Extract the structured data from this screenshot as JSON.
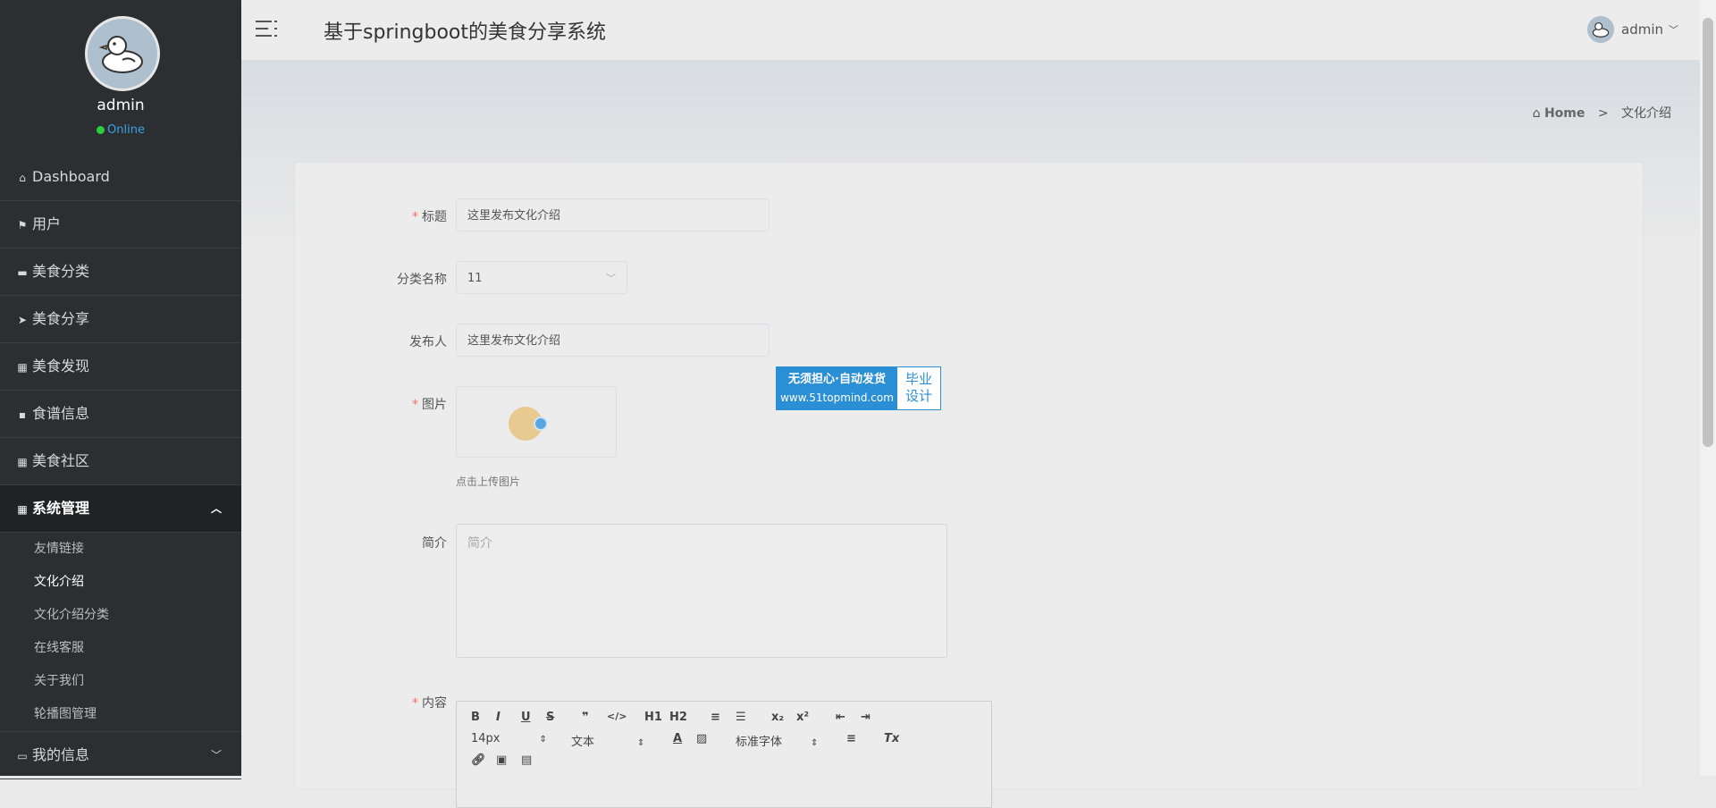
{
  "sidebar": {
    "user_name": "admin",
    "status": "Online",
    "items": [
      {
        "label": "Dashboard",
        "icon": "home-icon"
      },
      {
        "label": "用户",
        "icon": "flag-icon"
      },
      {
        "label": "美食分类",
        "icon": "ticket-icon"
      },
      {
        "label": "美食分享",
        "icon": "send-icon"
      },
      {
        "label": "美食发现",
        "icon": "grid-icon"
      },
      {
        "label": "食谱信息",
        "icon": "database-icon"
      },
      {
        "label": "美食社区",
        "icon": "grid-icon"
      },
      {
        "label": "系统管理",
        "icon": "grid-icon"
      },
      {
        "label": "我的信息",
        "icon": "card-icon"
      }
    ],
    "system_sub": [
      "友情链接",
      "文化介绍",
      "文化介绍分类",
      "在线客服",
      "关于我们",
      "轮播图管理"
    ]
  },
  "header": {
    "title": "基于springboot的美食分享系统",
    "user": "admin"
  },
  "breadcrumb": {
    "home": "Home",
    "separator": ">",
    "current": "文化介绍"
  },
  "form": {
    "title_label": "标题",
    "title_value": "这里发布文化介绍",
    "category_label": "分类名称",
    "category_value": "11",
    "publisher_label": "发布人",
    "publisher_value": "这里发布文化介绍",
    "image_label": "图片",
    "upload_tip": "点击上传图片",
    "intro_label": "简介",
    "intro_placeholder": "简介",
    "content_label": "内容"
  },
  "editor": {
    "font_size": "14px",
    "text_type": "文本",
    "font_family": "标准字体",
    "tools": [
      "B",
      "I",
      "U",
      "S",
      "❞",
      "</>",
      "H1",
      "H2",
      "x₂",
      "x²",
      "Tx"
    ]
  },
  "watermark": {
    "line1": "无须担心·自动发货",
    "line2": "www.51topmind.com",
    "side1": "毕业",
    "side2": "设计"
  }
}
